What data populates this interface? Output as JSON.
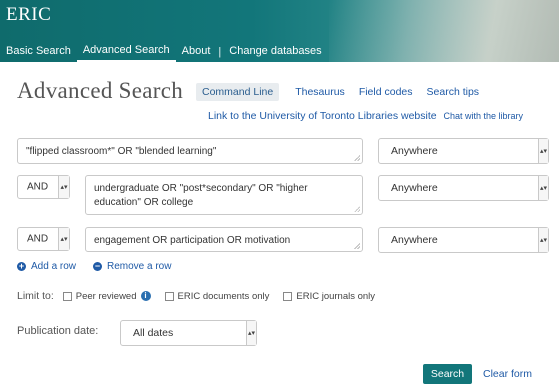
{
  "header": {
    "logo": "ERIC",
    "nav": [
      {
        "label": "Basic Search"
      },
      {
        "label": "Advanced Search"
      },
      {
        "label": "About"
      },
      {
        "label": "Change databases"
      }
    ],
    "separator": "|"
  },
  "page": {
    "title": "Advanced Search",
    "tabs": [
      "Command Line",
      "Thesaurus",
      "Field codes",
      "Search tips"
    ],
    "library_link": "Link to the University of Toronto Libraries website",
    "chat_link": "Chat with the library"
  },
  "search_rows": [
    {
      "operator": "",
      "query": "\"flipped classroom*\" OR \"blended learning\"",
      "field": "Anywhere"
    },
    {
      "operator": "AND",
      "query": "undergraduate OR \"post*secondary\" OR \"higher education\" OR college",
      "field": "Anywhere"
    },
    {
      "operator": "AND",
      "query": "engagement OR participation OR motivation",
      "field": "Anywhere"
    }
  ],
  "row_actions": {
    "add": "Add a row",
    "remove": "Remove a row",
    "add_icon": "+",
    "remove_icon": "−"
  },
  "limits": {
    "label": "Limit to:",
    "options": [
      "Peer reviewed",
      "ERIC documents only",
      "ERIC journals only"
    ],
    "info_icon": "i"
  },
  "publication_date": {
    "label": "Publication date:",
    "value": "All dates"
  },
  "buttons": {
    "search": "Search",
    "clear": "Clear form"
  },
  "icons": {
    "select_arrow": "▴▾",
    "add": "plus-circle-icon",
    "remove": "minus-circle-icon",
    "info": "info-icon"
  },
  "colors": {
    "header": "#12767a",
    "link": "#1f5aa6",
    "search_button": "#12767a"
  }
}
